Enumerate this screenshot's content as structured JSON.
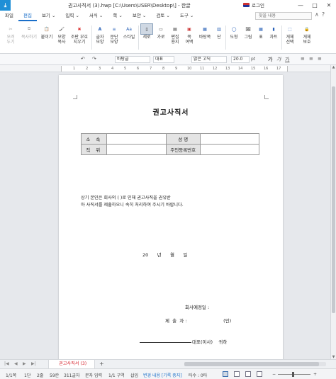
{
  "titlebar": {
    "logo": "⤓",
    "title": "권고사직서 (3).hwp [C:\\Users\\USER\\Desktop\\] - 한글",
    "login": "로그인",
    "minimize": "—",
    "maximize": "□",
    "close": "✕"
  },
  "menu": {
    "items": [
      "파일",
      "편집",
      "보기 ⌄",
      "입력 ⌄",
      "서식 ⌄",
      "쪽 ⌄",
      "보안 ⌄",
      "검토 ⌄",
      "도구 ⌄"
    ],
    "active_index": 1,
    "search_placeholder": "찾을 내용",
    "ribbon_toggles": [
      "∧",
      "?"
    ]
  },
  "ribbon": {
    "buttons": [
      {
        "label": "오려\n두기",
        "icon": "scissors-icon",
        "glyph": "✂",
        "enabled": false
      },
      {
        "label": "복사하기",
        "icon": "copy-icon",
        "glyph": "⧉",
        "enabled": false
      },
      {
        "label": "붙이기",
        "icon": "paste-icon",
        "glyph": "📋",
        "enabled": true
      },
      {
        "label": "모양\n복사",
        "icon": "format-painter-icon",
        "glyph": "🖌",
        "enabled": true
      },
      {
        "label": "조판 부호\n지우기",
        "icon": "clear-codes-icon",
        "glyph": "✖",
        "enabled": true
      },
      {
        "label": "글자\n모양",
        "icon": "char-shape-icon",
        "glyph": "A",
        "enabled": true
      },
      {
        "label": "문단\n모양",
        "icon": "para-shape-icon",
        "glyph": "≡",
        "enabled": true
      },
      {
        "label": "스타일",
        "icon": "style-icon",
        "glyph": "Aa",
        "enabled": true
      },
      {
        "label": "세로",
        "icon": "portrait-icon",
        "glyph": "▯",
        "enabled": true,
        "selected": true
      },
      {
        "label": "가로",
        "icon": "landscape-icon",
        "glyph": "▭",
        "enabled": true
      },
      {
        "label": "편집\n용지",
        "icon": "page-setup-icon",
        "glyph": "▤",
        "enabled": true
      },
      {
        "label": "쪽\n여백",
        "icon": "margin-icon",
        "glyph": "▣",
        "enabled": true
      },
      {
        "label": "바탕쪽",
        "icon": "master-page-icon",
        "glyph": "▦",
        "enabled": true
      },
      {
        "label": "단",
        "icon": "columns-icon",
        "glyph": "▥",
        "enabled": true
      },
      {
        "label": "도형",
        "icon": "shape-icon",
        "glyph": "◯",
        "enabled": true
      },
      {
        "label": "그림",
        "icon": "picture-icon",
        "glyph": "🖼",
        "enabled": true
      },
      {
        "label": "표",
        "icon": "table-icon",
        "glyph": "▦",
        "enabled": true
      },
      {
        "label": "차트",
        "icon": "chart-icon",
        "glyph": "▮",
        "enabled": true
      },
      {
        "label": "개체\n선택",
        "icon": "object-select-icon",
        "glyph": "⬚",
        "enabled": true
      },
      {
        "label": "개체\n보호",
        "icon": "object-protect-icon",
        "glyph": "🔒",
        "enabled": true
      }
    ]
  },
  "formatbar": {
    "style": "바탕글",
    "lang": "대표",
    "font": "맑은 고딕",
    "size": "20.0",
    "unit": "pt",
    "buttons": [
      "↶",
      "↷",
      "가",
      "가",
      "가",
      "≡",
      "≡",
      "≡"
    ]
  },
  "ruler": {
    "numbers": [
      "1",
      "2",
      "3",
      "4",
      "5",
      "6",
      "7",
      "8",
      "9",
      "10",
      "11",
      "12",
      "13",
      "14",
      "15",
      "16",
      "17"
    ]
  },
  "document": {
    "heading": "권고사직서",
    "table": {
      "row1": {
        "h1": "소  속",
        "h2": "성  명"
      },
      "row2": {
        "h1": "직  위",
        "h2": "주민등록번호"
      }
    },
    "body_line1": "상기 본인은 회사의 (                                        )로 인해 권고사직을 권유받",
    "body_line2": "아 사직서를 제출하오니 속히 처리하여 주시기 바랍니다.",
    "date_line": "20      년      월      일",
    "company_label": "회사예정일 :",
    "submitter_line": "제  출  자 :                         (인)",
    "ceo_line": "대표(이사)    귀하"
  },
  "tabs": {
    "nav": [
      "|◀",
      "◀",
      "▶",
      "▶|"
    ],
    "doc_tab": "권고사직서 (3)",
    "add": "+"
  },
  "status": {
    "page": "1/1쪽",
    "section": "1단",
    "line": "2줄",
    "col": "59칸",
    "chars": "311글자",
    "input_mode": "문자 입력",
    "area": "1/1 구역",
    "insert_mode": "삽입",
    "track_changes": "변경 내용 [기록 중지]",
    "hit": "타수 : 0타",
    "zoom_minus": "−",
    "zoom_plus": "+",
    "zoom_value": 0.45
  }
}
